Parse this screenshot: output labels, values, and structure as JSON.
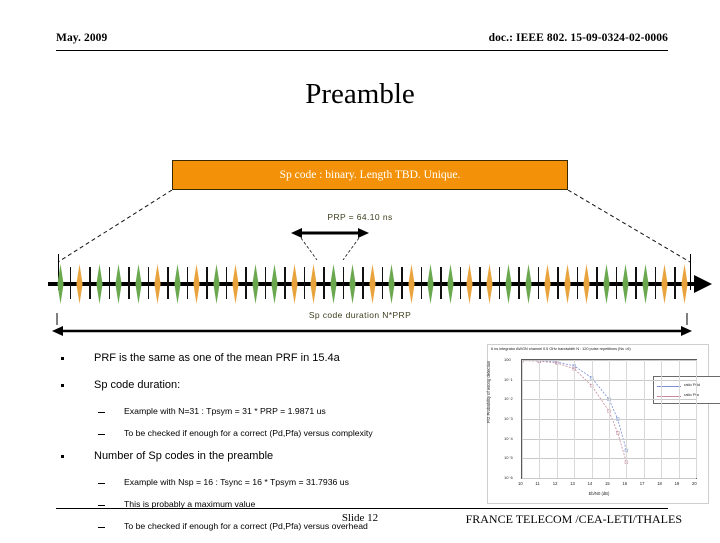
{
  "header": {
    "date": "May. 2009",
    "doc": "doc.: IEEE 802. 15-09-0324-02-0006"
  },
  "title": "Preamble",
  "diagram": {
    "sp_box_label": "Sp code : binary. Length TBD. Unique.",
    "prp_label": "PRP  = 64.10 ns",
    "duration_label": "Sp code duration  N*PRP",
    "colors": {
      "orange": "#F39208",
      "pulse_green": "#6aa84f",
      "pulse_orange": "#e8a33d",
      "axis": "#000000"
    },
    "pulse_sequence": [
      "green",
      "orange",
      "green",
      "green",
      "green",
      "orange",
      "green",
      "orange",
      "green",
      "orange",
      "green",
      "green",
      "orange",
      "orange",
      "green",
      "green",
      "orange",
      "green",
      "orange",
      "green",
      "green",
      "orange",
      "orange",
      "green",
      "green",
      "orange",
      "orange",
      "orange",
      "green",
      "green",
      "green",
      "orange",
      "orange"
    ]
  },
  "bullets": [
    {
      "level": 1,
      "text": "PRF is the same as one of the mean PRF in 15.4a"
    },
    {
      "level": 1,
      "text": "Sp code duration:"
    },
    {
      "level": 2,
      "text": "Example with N=31 : Tpsym = 31 * PRP = 1.9871 us"
    },
    {
      "level": 2,
      "text": "To be checked if enough for a correct (Pd,Pfa) versus complexity"
    },
    {
      "level": 1,
      "text": "Number of Sp codes in the preamble"
    },
    {
      "level": 2,
      "text": "Example with Nsp = 16 :  Tsync = 16 * Tpsym = 31.7936 us"
    },
    {
      "level": 2,
      "text": "This is probably a maximum value"
    },
    {
      "level": 2,
      "text": "To be checked if enough for a correct (Pd,Pfa) versus overhead"
    }
  ],
  "chart_data": {
    "type": "line",
    "title": "6 ns integrator   AWGN channel 0.5 GHz bandwidth   N :  120 pulse repetitions (Ns =6)",
    "xlabel": "Eb/N0 (dB)",
    "ylabel": "P/2  Probability of wrong detection",
    "xlim": [
      10,
      20
    ],
    "xticks": [
      10,
      11,
      12,
      13,
      14,
      15,
      16,
      17,
      18,
      19,
      20
    ],
    "ylim_exponents": [
      -6,
      0
    ],
    "yticks": [
      "10^0",
      "10^-1",
      "10^-2",
      "10^-3",
      "10^-4",
      "10^-5",
      "10^-6"
    ],
    "grid": true,
    "legend_position": "top-right",
    "series": [
      {
        "name": "ratio Pdd",
        "x": [
          10,
          11,
          12,
          13,
          14,
          15,
          15.5,
          16
        ],
        "y_exponents": [
          -0.02,
          -0.04,
          -0.1,
          -0.3,
          -0.9,
          -2.0,
          -3.0,
          -4.6
        ]
      },
      {
        "name": "ratio Pfa",
        "x": [
          10,
          11,
          12,
          13,
          14,
          15,
          15.5,
          16
        ],
        "y_exponents": [
          -0.03,
          -0.06,
          -0.15,
          -0.45,
          -1.3,
          -2.6,
          -3.7,
          -5.2
        ]
      }
    ],
    "legend": [
      "ratio Pdd",
      "ratio Pfa"
    ]
  },
  "footer": {
    "slide": "Slide 12",
    "org": "FRANCE TELECOM /CEA-LETI/THALES"
  }
}
